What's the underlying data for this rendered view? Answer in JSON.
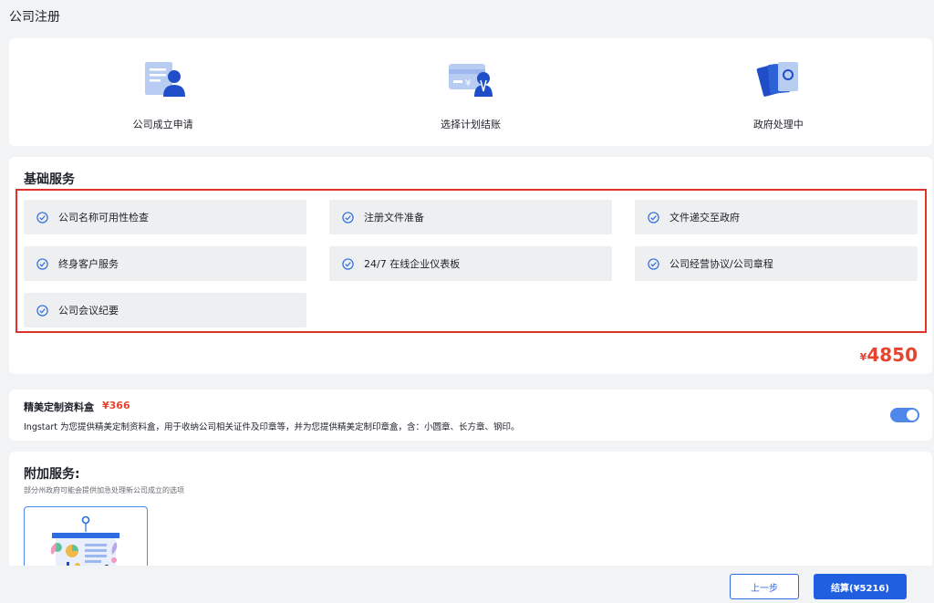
{
  "page": {
    "title": "公司注册"
  },
  "steps": [
    {
      "label": "公司成立申请",
      "icon": "document-person-icon"
    },
    {
      "label": "选择计划结账",
      "icon": "payment-card-icon"
    },
    {
      "label": "政府处理中",
      "icon": "documents-stack-icon"
    }
  ],
  "basic": {
    "title": "基础服务",
    "services": [
      "公司名称可用性检查",
      "注册文件准备",
      "文件递交至政府",
      "终身客户服务",
      "24/7 在线企业仪表板",
      "公司经营协议/公司章程",
      "公司会议纪要"
    ],
    "price_symbol": "¥",
    "price": "4850"
  },
  "box": {
    "title": "精美定制资料盒",
    "price": "¥366",
    "description": "Ingstart 为您提供精美定制资料盒，用于收纳公司相关证件及印章等，并为您提供精美定制印章盒，含：小圆章、长方章、钢印。",
    "toggle_on": true
  },
  "addon": {
    "title": "附加服务:",
    "subtitle": "部分州政府可能会提供加急处理新公司成立的选项"
  },
  "footer": {
    "prev_label": "上一步",
    "pay_label": "结算(¥5216)"
  },
  "colors": {
    "accent": "#1f5fe0",
    "price_red": "#e5452f",
    "highlight_border": "#e0332b"
  }
}
